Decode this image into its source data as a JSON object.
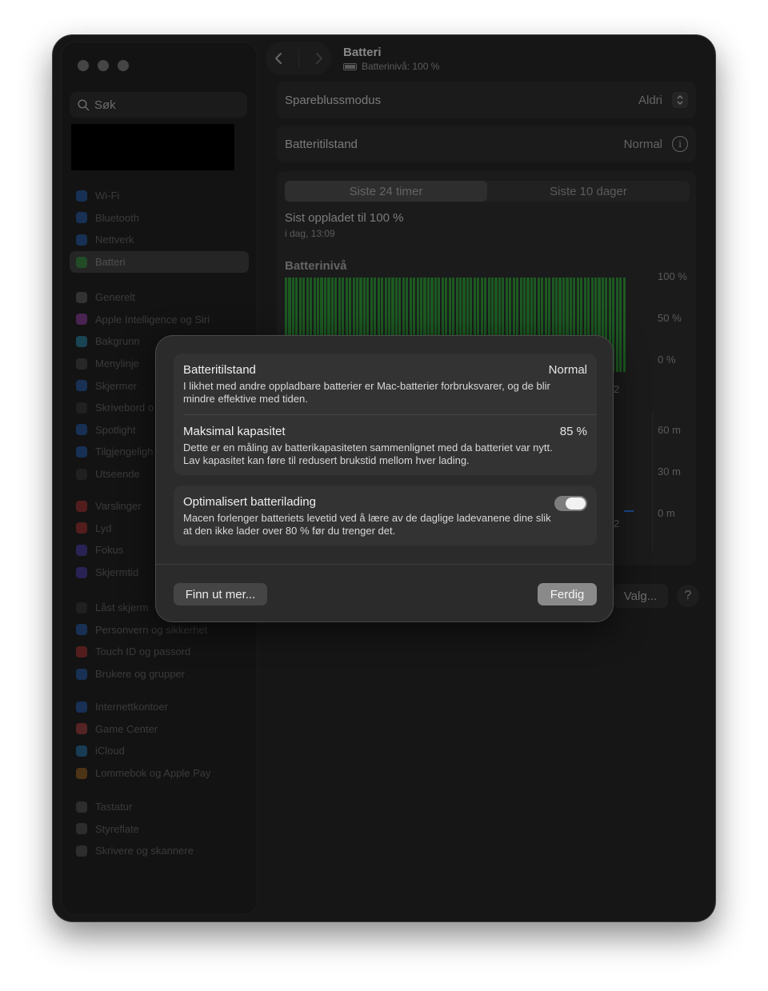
{
  "sidebar": {
    "search_placeholder": "Søk",
    "groups": [
      [
        {
          "label": "Wi-Fi",
          "color": "#2a6fd6"
        },
        {
          "label": "Bluetooth",
          "color": "#2a6fd6"
        },
        {
          "label": "Nettverk",
          "color": "#2a6fd6"
        },
        {
          "label": "Batteri",
          "color": "#2fa53c",
          "active": true
        }
      ],
      [
        {
          "label": "Generelt",
          "color": "#777"
        },
        {
          "label": "Apple Intelligence og Siri",
          "color": "#b54ad0"
        },
        {
          "label": "Bakgrunn",
          "color": "#2ea7d6"
        },
        {
          "label": "Menylinje",
          "color": "#555"
        },
        {
          "label": "Skjermer",
          "color": "#2a6fd6"
        },
        {
          "label": "Skrivebord o",
          "color": "#444"
        },
        {
          "label": "Spotlight",
          "color": "#2a6fd6"
        },
        {
          "label": "Tilgjengeligh",
          "color": "#2a6fd6"
        },
        {
          "label": "Utseende",
          "color": "#444"
        }
      ],
      [
        {
          "label": "Varslinger",
          "color": "#d63a3a"
        },
        {
          "label": "Lyd",
          "color": "#d63a3a"
        },
        {
          "label": "Fokus",
          "color": "#5a4ad6"
        },
        {
          "label": "Skjermtid",
          "color": "#5a4ad6"
        }
      ],
      [
        {
          "label": "Låst skjerm",
          "color": "#444"
        },
        {
          "label": "Personvern og sikkerhet",
          "color": "#2a6fd6"
        },
        {
          "label": "Touch ID og passord",
          "color": "#d63a3a"
        },
        {
          "label": "Brukere og grupper",
          "color": "#2a6fd6"
        }
      ],
      [
        {
          "label": "Internettkontoer",
          "color": "#2a6fd6"
        },
        {
          "label": "Game Center",
          "color": "#d64a4a"
        },
        {
          "label": "iCloud",
          "color": "#2a8fd6"
        },
        {
          "label": "Lommebok og Apple Pay",
          "color": "#c47a2a"
        }
      ],
      [
        {
          "label": "Tastatur",
          "color": "#666"
        },
        {
          "label": "Styreflate",
          "color": "#666"
        },
        {
          "label": "Skrivere og skannere",
          "color": "#666"
        }
      ]
    ]
  },
  "header": {
    "title": "Batteri",
    "subtitle": "Batterinivå: 100 %"
  },
  "settings": {
    "power_saving_label": "Spareblussmodus",
    "power_saving_value": "Aldri",
    "health_label": "Batteritilstand",
    "health_value": "Normal"
  },
  "history": {
    "tabs": [
      "Siste 24 timer",
      "Siste 10 dager"
    ],
    "selected_tab": 0,
    "last_charged": "Sist oppladet til 100 %",
    "last_charged_time": "i dag, 13:09",
    "chart_title": "Batterinivå",
    "level_ticks": [
      "100 %",
      "50 %",
      "0 %"
    ],
    "usage_ticks": [
      "60 m",
      "30 m",
      "0 m"
    ],
    "partial_x_label": "2"
  },
  "chart_data": {
    "type": "bar",
    "title": "Batterinivå",
    "series": [
      {
        "values": [
          100,
          100,
          100,
          100,
          100,
          100,
          100,
          100,
          100,
          100,
          100,
          100,
          100,
          100,
          100,
          100,
          100,
          100,
          100,
          100,
          100,
          100,
          100,
          100,
          100,
          100,
          100,
          100,
          100,
          100,
          100,
          100,
          100,
          100,
          100,
          100,
          100,
          100,
          100,
          100,
          100,
          100,
          100,
          100,
          100,
          100,
          100,
          100,
          100,
          100,
          100,
          100,
          100,
          100,
          100,
          100,
          100,
          100,
          100,
          100,
          100,
          100,
          100,
          100,
          100,
          100,
          100,
          100,
          100,
          100,
          100,
          100,
          100,
          100,
          100,
          100,
          100,
          100,
          100,
          100,
          100,
          100,
          100,
          100,
          100,
          100,
          100,
          100,
          100,
          100,
          100,
          100,
          100,
          100,
          100,
          100
        ]
      }
    ],
    "ylim": [
      0,
      100
    ],
    "ytick_labels": [
      "100 %",
      "50 %",
      "0 %"
    ]
  },
  "footer": {
    "options_label": "Valg...",
    "help_label": "?"
  },
  "modal": {
    "health_title": "Batteritilstand",
    "health_value": "Normal",
    "health_desc": "I likhet med andre oppladbare batterier er Mac-batterier forbruksvarer, og de blir mindre effektive med tiden.",
    "capacity_title": "Maksimal kapasitet",
    "capacity_value": "85 %",
    "capacity_desc": "Dette er en måling av batterikapasiteten sammenlignet med da batteriet var nytt. Lav kapasitet kan føre til redusert brukstid mellom hver lading.",
    "optimized_title": "Optimalisert batterilading",
    "optimized_on": true,
    "optimized_desc": "Macen forlenger batteriets levetid ved å lære av de daglige ladevanene dine slik at den ikke lader over 80 % før du trenger det.",
    "learn_more_label": "Finn ut mer...",
    "done_label": "Ferdig"
  }
}
